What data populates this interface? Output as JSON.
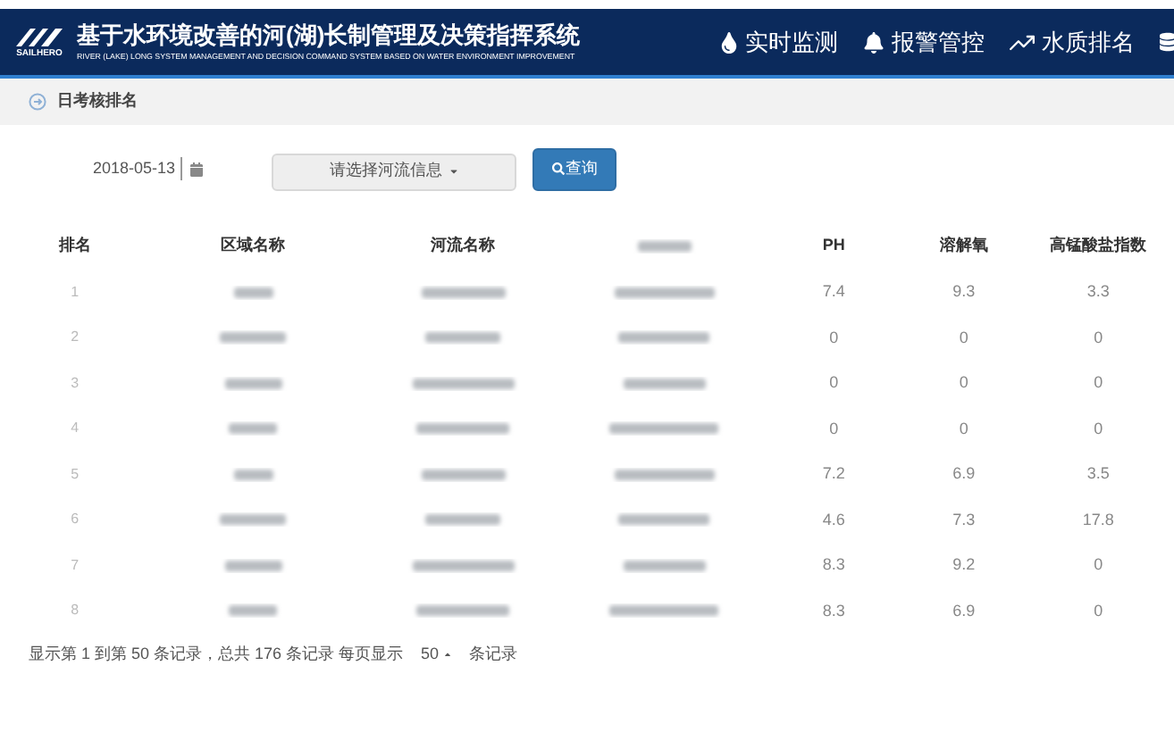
{
  "header": {
    "logo_text": "SAILHERO",
    "title": "基于水环境改善的河(湖)长制管理及决策指挥系统",
    "subtitle": "RIVER (LAKE) LONG SYSTEM MANAGEMENT AND DECISION COMMAND SYSTEM BASED ON WATER ENVIRONMENT IMPROVEMENT",
    "nav": [
      {
        "label": "实时监测"
      },
      {
        "label": "报警管控"
      },
      {
        "label": "水质排名"
      }
    ]
  },
  "breadcrumb": "日考核排名",
  "filters": {
    "date": "2018-05-13",
    "river_select": "请选择河流信息",
    "query_button": "查询"
  },
  "table": {
    "columns": [
      "排名",
      "区域名称",
      "河流名称",
      null,
      "PH",
      "溶解氧",
      "高锰酸盐指数"
    ],
    "rows": [
      [
        "1",
        "7.4",
        "9.3",
        "3.3"
      ],
      [
        "2",
        "0",
        "0",
        "0"
      ],
      [
        "3",
        "0",
        "0",
        "0"
      ],
      [
        "4",
        "0",
        "0",
        "0"
      ],
      [
        "5",
        "7.2",
        "6.9",
        "3.5"
      ],
      [
        "6",
        "4.6",
        "7.3",
        "17.8"
      ],
      [
        "7",
        "8.3",
        "9.2",
        "0"
      ],
      [
        "8",
        "8.3",
        "6.9",
        "0"
      ]
    ]
  },
  "pagination": {
    "summary": "显示第 1 到第 50 条记录，总共 176 条记录 每页显示",
    "page_size": "50",
    "suffix": "条记录"
  }
}
